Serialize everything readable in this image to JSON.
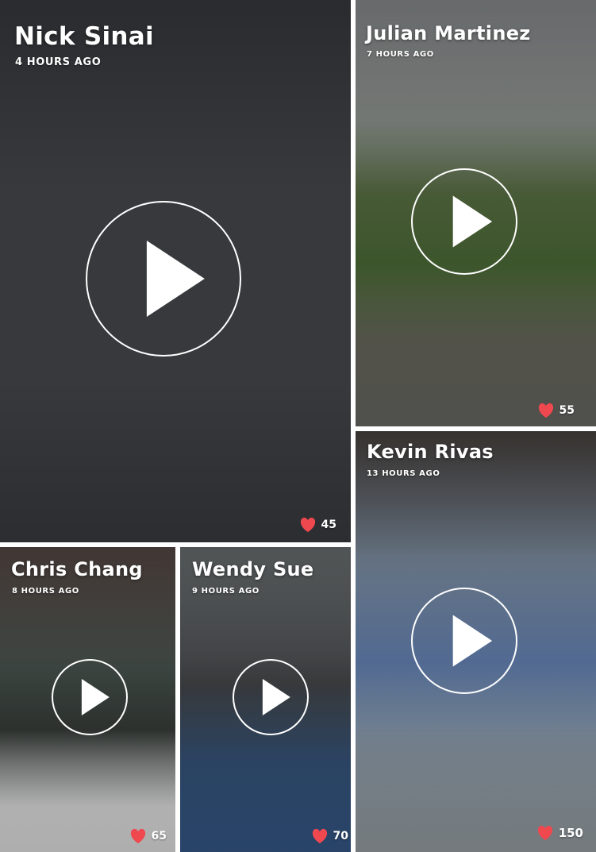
{
  "accent_heart_color": "#f0484f",
  "tiles": [
    {
      "name": "Nick Sinai",
      "time": "4 HOURS AGO",
      "likes": "45",
      "icon": "play-icon"
    },
    {
      "name": "Julian Martinez",
      "time": "7 HOURS AGO",
      "likes": "55",
      "icon": "play-icon"
    },
    {
      "name": "Kevin Rivas",
      "time": "13 HOURS AGO",
      "likes": "150",
      "icon": "play-icon"
    },
    {
      "name": "Chris Chang",
      "time": "8 HOURS AGO",
      "likes": "65",
      "icon": "play-icon"
    },
    {
      "name": "Wendy Sue",
      "time": "9 HOURS AGO",
      "likes": "70",
      "icon": "play-icon"
    }
  ]
}
